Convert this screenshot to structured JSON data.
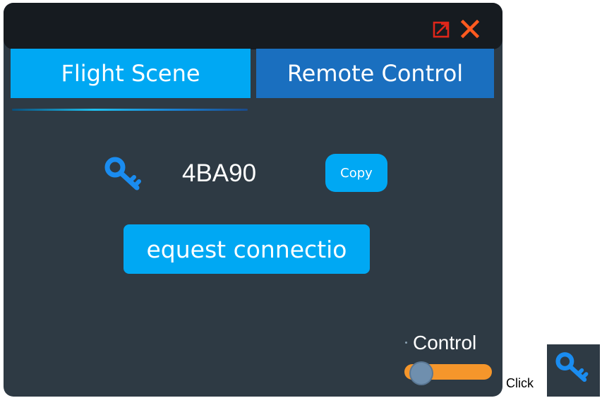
{
  "window": {
    "restore_icon": "restore-icon",
    "close_icon": "close-icon",
    "close_color": "#ff5a1f",
    "restore_color": "#e0261a"
  },
  "tabs": [
    {
      "label": "Flight Scene",
      "active": true
    },
    {
      "label": "Remote Control",
      "active": false
    }
  ],
  "connection": {
    "key_icon": "key-icon",
    "code": "4BA90",
    "copy_label": "Copy",
    "request_label": "equest connectio"
  },
  "control": {
    "label": "Control",
    "slider_value": 0.1
  },
  "hint": {
    "text": "Click",
    "icon": "key-icon"
  },
  "colors": {
    "accent": "#00a8f3",
    "tab_inactive": "#1a6fbf",
    "panel_bg": "#2e3a44",
    "titlebar_bg": "#161b20",
    "slider_track": "#f5962b",
    "key_blue": "#1a8cf0"
  }
}
